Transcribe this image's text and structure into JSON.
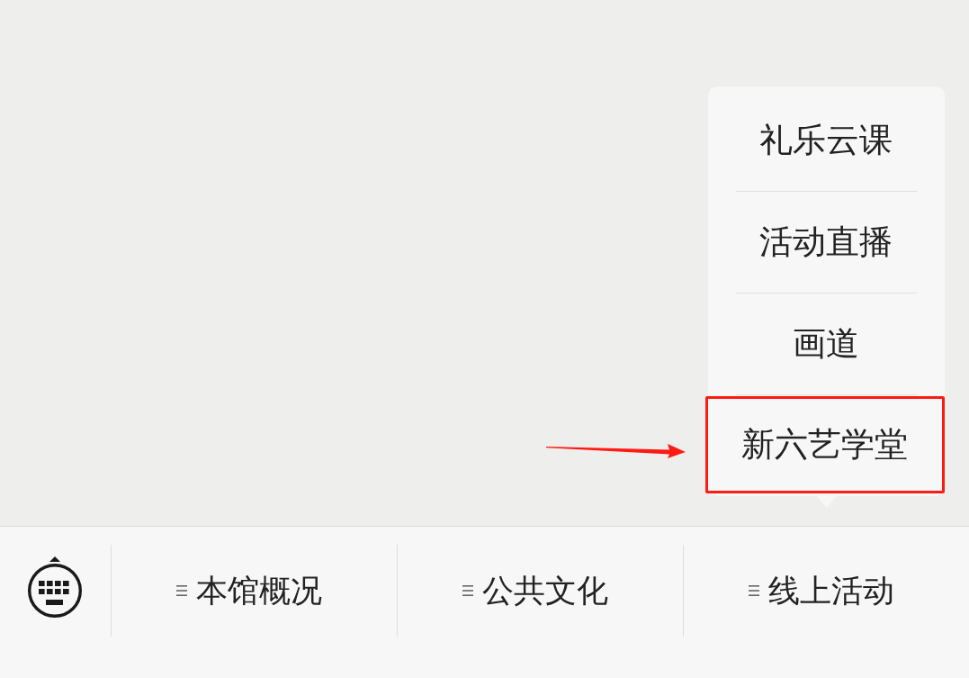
{
  "bottom_menu": {
    "items": [
      {
        "label": "本馆概况"
      },
      {
        "label": "公共文化"
      },
      {
        "label": "线上活动",
        "submenu": [
          {
            "label": "礼乐云课",
            "highlighted": false
          },
          {
            "label": "活动直播",
            "highlighted": false
          },
          {
            "label": "画道",
            "highlighted": false
          },
          {
            "label": "新六艺学堂",
            "highlighted": true
          }
        ]
      }
    ]
  }
}
